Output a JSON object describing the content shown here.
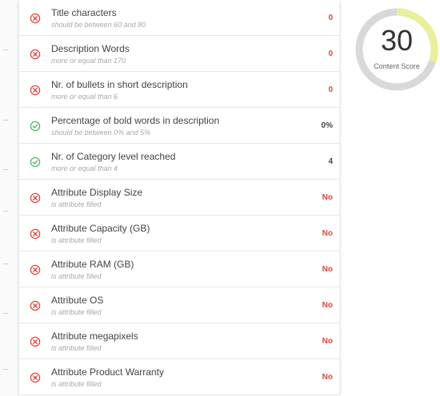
{
  "checks": [
    {
      "title": "Title characters",
      "subtitle": "should be between 60 and 80",
      "value": "0",
      "status": "fail"
    },
    {
      "title": "Description Words",
      "subtitle": "more or equal than 170",
      "value": "0",
      "status": "fail"
    },
    {
      "title": "Nr. of bullets in short description",
      "subtitle": "more or equal than 6",
      "value": "0",
      "status": "fail"
    },
    {
      "title": "Percentage of bold words in description",
      "subtitle": "should be between 0% and 5%",
      "value": "0%",
      "status": "pass"
    },
    {
      "title": "Nr. of Category level reached",
      "subtitle": "more or equal than 4",
      "value": "4",
      "status": "pass"
    },
    {
      "title": "Attribute Display Size",
      "subtitle": "is attribute filled",
      "value": "No",
      "status": "fail"
    },
    {
      "title": "Attribute Capacity (GB)",
      "subtitle": "is attribute filled",
      "value": "No",
      "status": "fail"
    },
    {
      "title": "Attribute RAM (GB)",
      "subtitle": "is attribute filled",
      "value": "No",
      "status": "fail"
    },
    {
      "title": "Attribute OS",
      "subtitle": "is attribute filled",
      "value": "No",
      "status": "fail"
    },
    {
      "title": "Attribute megapixels",
      "subtitle": "is attribute filled",
      "value": "No",
      "status": "fail"
    },
    {
      "title": "Attribute Product Warranty",
      "subtitle": "is attribute filled",
      "value": "No",
      "status": "fail"
    }
  ],
  "score": {
    "value": "30",
    "label": "Content Score",
    "fraction": 0.3
  },
  "colors": {
    "fail": "#e0463e",
    "pass": "#4cba6b",
    "ring_track": "#d9d9d9",
    "ring_progress": "#e9ef9a"
  },
  "icons": {
    "fail": "x-circle-icon",
    "pass": "check-circle-icon"
  }
}
